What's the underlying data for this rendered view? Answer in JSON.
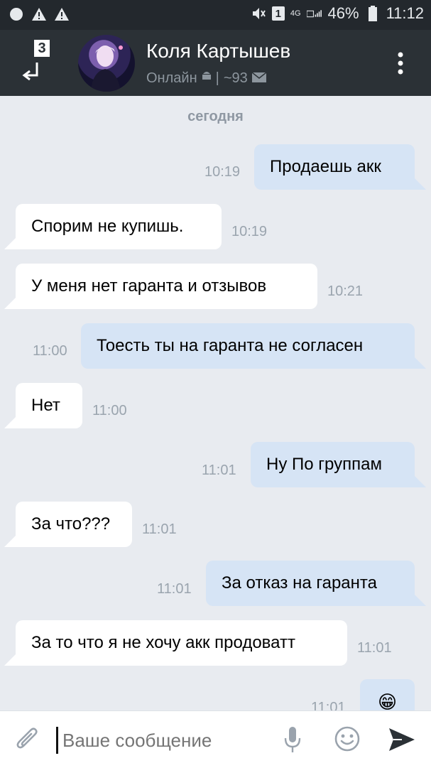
{
  "status_bar": {
    "battery": "46%",
    "time": "11:12",
    "network": "4G",
    "sim": "1"
  },
  "header": {
    "back_count": "3",
    "name": "Коля Картышев",
    "status": "Онлайн",
    "separator": "|",
    "friends": "~93"
  },
  "date_label": "сегодня",
  "messages": [
    {
      "side": "out",
      "text": "Продаешь акк",
      "time": "10:19"
    },
    {
      "side": "in",
      "text": "Спорим не купишь.",
      "time": "10:19"
    },
    {
      "side": "in",
      "text": "У меня нет гаранта и отзывов",
      "time": "10:21"
    },
    {
      "side": "out",
      "text": "Тоесть ты на гаранта не согласен",
      "time": "11:00"
    },
    {
      "side": "in",
      "text": "Нет",
      "time": "11:00"
    },
    {
      "side": "out",
      "text": "Ну По группам",
      "time": "11:01"
    },
    {
      "side": "in",
      "text": "За что???",
      "time": "11:01"
    },
    {
      "side": "out",
      "text": "За отказ на гаранта",
      "time": "11:01"
    },
    {
      "side": "in",
      "text": "За то что я не хочу акк продоватт",
      "time": "11:01"
    },
    {
      "side": "out",
      "text": "😁",
      "time": "11:01"
    }
  ],
  "composer": {
    "placeholder": "Ваше сообщение"
  },
  "colors": {
    "header_bg": "#2b3136",
    "chat_bg": "#e8ebf0",
    "outgoing_bubble": "#d6e4f5",
    "incoming_bubble": "#ffffff",
    "accent": "#5181b8"
  }
}
